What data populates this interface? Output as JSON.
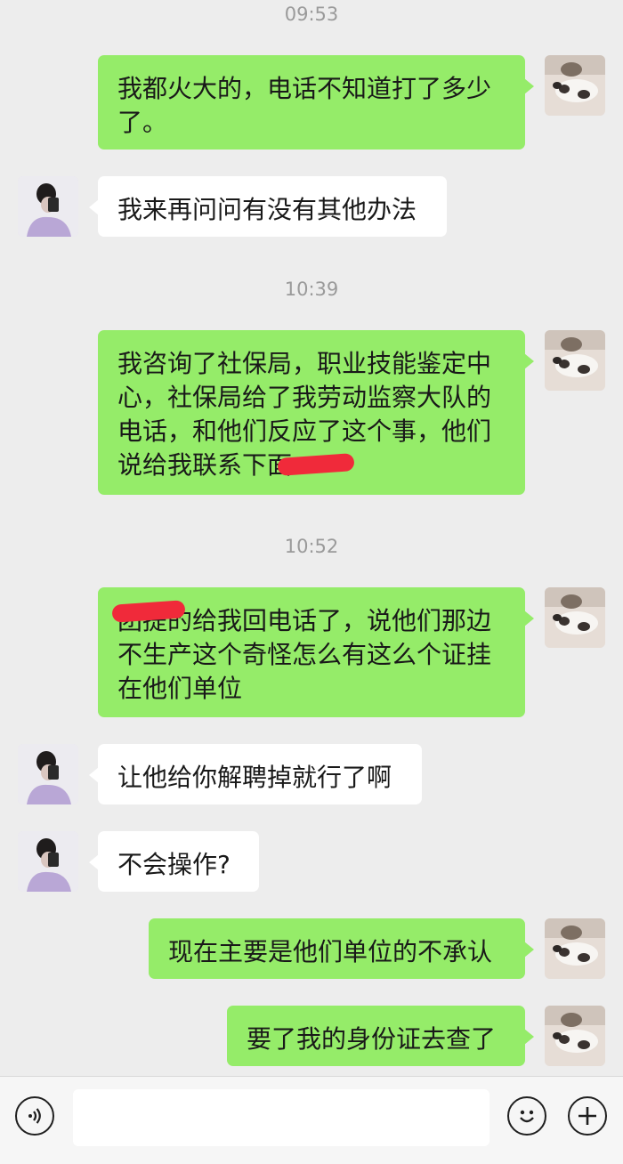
{
  "chat": {
    "times": [
      "09:53",
      "10:39",
      "10:52"
    ],
    "messages": [
      {
        "from": "me",
        "text": "我都火大的，电话不知道打了多少了。"
      },
      {
        "from": "other",
        "text": "我来再问问有没有其他办法"
      },
      {
        "from": "me",
        "text": "我咨询了社保局，职业技能鉴定中心，社保局给了我劳动监察大队的电话，和他们反应了这个事，他们说给我联系下面"
      },
      {
        "from": "me",
        "text": "团提的给我回电话了，说他们那边不生产这个奇怪怎么有这么个证挂在他们单位"
      },
      {
        "from": "other",
        "text": "让他给你解聘掉就行了啊"
      },
      {
        "from": "other",
        "text": "不会操作?"
      },
      {
        "from": "me",
        "text": "现在主要是他们单位的不承认"
      },
      {
        "from": "me",
        "text": "要了我的身份证去查了"
      }
    ]
  },
  "input_bar": {
    "voice_icon": "voice-icon",
    "emoji_icon": "emoji-icon",
    "plus_icon": "plus-icon",
    "input_value": ""
  },
  "colors": {
    "my_bubble": "#95ec69",
    "other_bubble": "#ffffff",
    "background": "#ededed",
    "redaction": "#f02a3a"
  }
}
